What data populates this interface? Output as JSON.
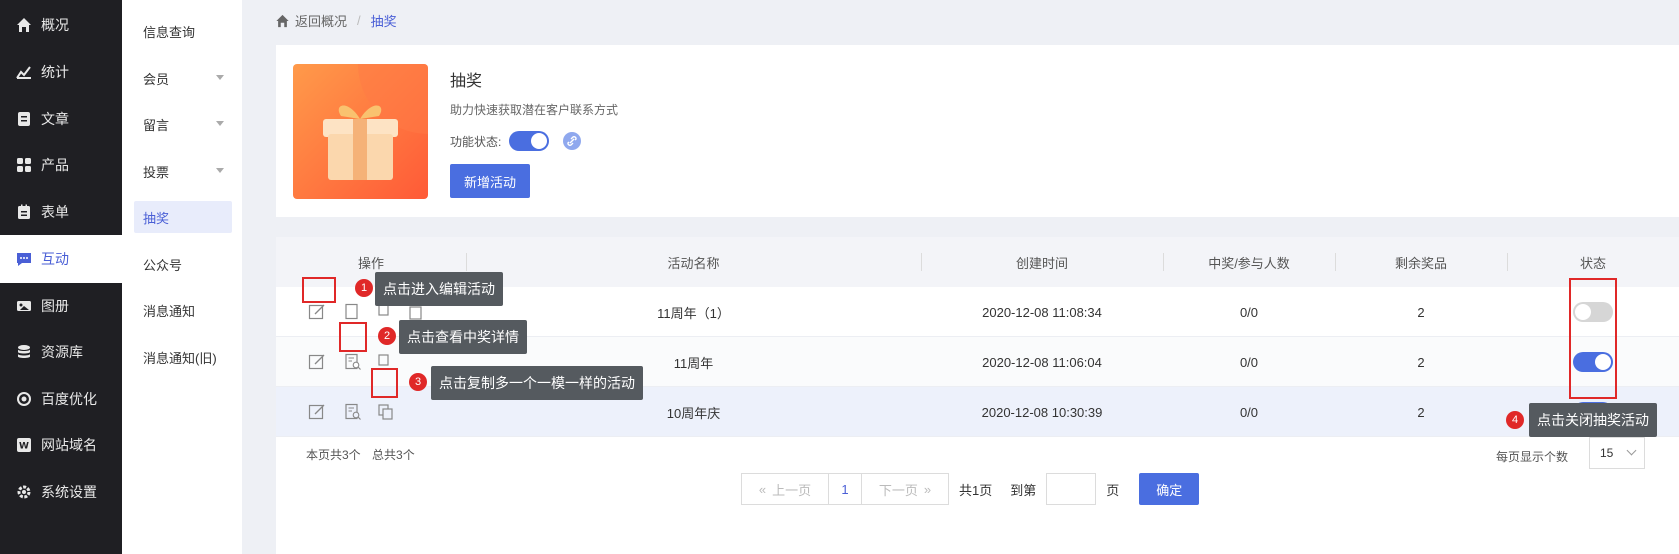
{
  "sidebar": {
    "items": [
      {
        "label": "概况",
        "icon": "home-icon"
      },
      {
        "label": "统计",
        "icon": "chart-icon"
      },
      {
        "label": "文章",
        "icon": "article-icon"
      },
      {
        "label": "产品",
        "icon": "grid-icon"
      },
      {
        "label": "表单",
        "icon": "form-icon"
      },
      {
        "label": "互动",
        "icon": "chat-icon"
      },
      {
        "label": "图册",
        "icon": "album-icon"
      },
      {
        "label": "资源库",
        "icon": "database-icon"
      },
      {
        "label": "百度优化",
        "icon": "seo-icon"
      },
      {
        "label": "网站域名",
        "icon": "domain-icon"
      },
      {
        "label": "系统设置",
        "icon": "gear-icon"
      }
    ]
  },
  "subnav": {
    "items": [
      {
        "label": "信息查询"
      },
      {
        "label": "会员"
      },
      {
        "label": "留言"
      },
      {
        "label": "投票"
      },
      {
        "label": "抽奖"
      },
      {
        "label": "公众号"
      },
      {
        "label": "消息通知"
      },
      {
        "label": "消息通知(旧)"
      }
    ]
  },
  "breadcrumb": {
    "back": "返回概况",
    "sep": "/",
    "current": "抽奖"
  },
  "feature": {
    "title": "抽奖",
    "desc": "助力快速获取潜在客户联系方式",
    "status_label": "功能状态:",
    "add_button": "新增活动"
  },
  "table": {
    "headers": [
      "操作",
      "活动名称",
      "创建时间",
      "中奖/参与人数",
      "剩余奖品",
      "状态"
    ],
    "rows": [
      {
        "name": "11周年（1）",
        "created": "2020-12-08 11:08:34",
        "ratio": "0/0",
        "prizes": "2",
        "enabled": false
      },
      {
        "name": "11周年",
        "created": "2020-12-08 11:06:04",
        "ratio": "0/0",
        "prizes": "2",
        "enabled": true
      },
      {
        "name": "10周年庆",
        "created": "2020-12-08 10:30:39",
        "ratio": "0/0",
        "prizes": "2",
        "enabled": true
      }
    ]
  },
  "tips": [
    {
      "num": "1",
      "text": "点击进入编辑活动"
    },
    {
      "num": "2",
      "text": "点击查看中奖详情"
    },
    {
      "num": "3",
      "text": "点击复制多一个一模一样的活动"
    },
    {
      "num": "4",
      "text": "点击关闭抽奖活动"
    }
  ],
  "pagination": {
    "page_count_text": "本页共3个",
    "total_text": "总共3个",
    "per_page_label": "每页显示个数",
    "per_page_value": "15",
    "prev": "上一页",
    "current": "1",
    "next": "下一页",
    "total_pages": "共1页",
    "goto_label": "到第",
    "page_unit": "页",
    "confirm": "确定"
  },
  "colors": {
    "accent": "#4a6ee0",
    "sidebar_bg": "#1f1f23",
    "highlight_red": "#e02828"
  }
}
